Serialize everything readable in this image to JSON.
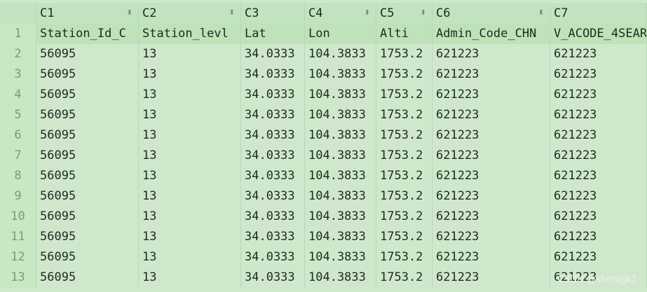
{
  "columns": [
    "C1",
    "C2",
    "C3",
    "C4",
    "C5",
    "C6",
    "C7"
  ],
  "rows": [
    {
      "num": "1",
      "cells": [
        "Station_Id_C",
        "Station_levl",
        "Lat",
        "Lon",
        "Alti",
        "Admin_Code_CHN",
        "V_ACODE_4SEAR"
      ]
    },
    {
      "num": "2",
      "cells": [
        "56095",
        "13",
        "34.0333",
        "104.3833",
        "1753.2",
        "621223",
        "621223"
      ]
    },
    {
      "num": "3",
      "cells": [
        "56095",
        "13",
        "34.0333",
        "104.3833",
        "1753.2",
        "621223",
        "621223"
      ]
    },
    {
      "num": "4",
      "cells": [
        "56095",
        "13",
        "34.0333",
        "104.3833",
        "1753.2",
        "621223",
        "621223"
      ]
    },
    {
      "num": "5",
      "cells": [
        "56095",
        "13",
        "34.0333",
        "104.3833",
        "1753.2",
        "621223",
        "621223"
      ]
    },
    {
      "num": "6",
      "cells": [
        "56095",
        "13",
        "34.0333",
        "104.3833",
        "1753.2",
        "621223",
        "621223"
      ]
    },
    {
      "num": "7",
      "cells": [
        "56095",
        "13",
        "34.0333",
        "104.3833",
        "1753.2",
        "621223",
        "621223"
      ]
    },
    {
      "num": "8",
      "cells": [
        "56095",
        "13",
        "34.0333",
        "104.3833",
        "1753.2",
        "621223",
        "621223"
      ]
    },
    {
      "num": "9",
      "cells": [
        "56095",
        "13",
        "34.0333",
        "104.3833",
        "1753.2",
        "621223",
        "621223"
      ]
    },
    {
      "num": "10",
      "cells": [
        "56095",
        "13",
        "34.0333",
        "104.3833",
        "1753.2",
        "621223",
        "621223"
      ]
    },
    {
      "num": "11",
      "cells": [
        "56095",
        "13",
        "34.0333",
        "104.3833",
        "1753.2",
        "621223",
        "621223"
      ]
    },
    {
      "num": "12",
      "cells": [
        "56095",
        "13",
        "34.0333",
        "104.3833",
        "1753.2",
        "621223",
        "621223"
      ]
    },
    {
      "num": "13",
      "cells": [
        "56095",
        "13",
        "34.0333",
        "104.3833",
        "1753.2",
        "621223",
        "621223"
      ]
    }
  ],
  "watermark": "CSDN @shengjk1",
  "sort_icon": "sort-arrows-icon"
}
